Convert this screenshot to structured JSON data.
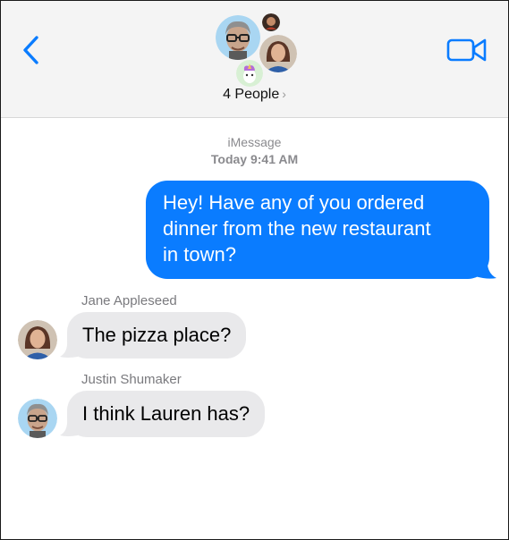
{
  "header": {
    "participants_label": "4 People",
    "back_icon": "chevron-left-icon",
    "video_icon": "video-camera-icon",
    "accent": "#0a7cff"
  },
  "conversation": {
    "service": "iMessage",
    "timestamp": "Today 9:41 AM",
    "messages": [
      {
        "direction": "sent",
        "text": "Hey! Have any of you ordered dinner from the new restaurant in town?",
        "lines": [
          "Hey! Have any of you ordered",
          "dinner from the new restaurant",
          "in town?"
        ]
      },
      {
        "direction": "received",
        "sender": "Jane Appleseed",
        "text": "The pizza place?"
      },
      {
        "direction": "received",
        "sender": "Justin Shumaker",
        "text": "I think Lauren has?"
      }
    ]
  },
  "colors": {
    "sent_bubble": "#0a7cff",
    "received_bubble": "#e9e9eb",
    "header_bg": "#f4f4f4"
  }
}
